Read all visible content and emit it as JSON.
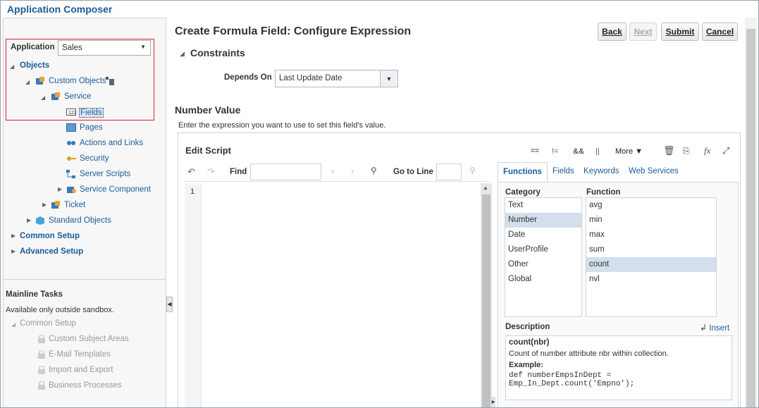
{
  "app_title": "Application Composer",
  "left": {
    "application_label": "Application",
    "application_value": "Sales",
    "tree": {
      "objects": "Objects",
      "custom_objects": "Custom Objects",
      "service": "Service",
      "fields": "Fields",
      "pages": "Pages",
      "actions_links": "Actions and Links",
      "security": "Security",
      "server_scripts": "Server Scripts",
      "service_component": "Service Component",
      "ticket": "Ticket",
      "standard_objects": "Standard Objects",
      "common_setup": "Common Setup",
      "advanced_setup": "Advanced Setup"
    },
    "tasks": {
      "title": "Mainline Tasks",
      "note": "Available only outside sandbox.",
      "common_setup": "Common Setup",
      "items": [
        "Custom Subject Areas",
        "E-Mail Templates",
        "Import and Export",
        "Business Processes"
      ]
    }
  },
  "main": {
    "title": "Create Formula Field: Configure Expression",
    "buttons": {
      "back": "Back",
      "next": "Next",
      "submit": "Submit",
      "cancel": "Cancel"
    },
    "constraints": "Constraints",
    "depends_on_label": "Depends On",
    "depends_on_value": "Last Update Date",
    "number_value": "Number Value",
    "instructions": "Enter the expression you want to use to set this field's value.",
    "edit_script": "Edit Script",
    "more": "More",
    "find": "Find",
    "go_to_line": "Go to Line",
    "line_number": "1",
    "tabs": [
      "Functions",
      "Fields",
      "Keywords",
      "Web Services"
    ],
    "category_label": "Category",
    "function_label": "Function",
    "categories": [
      "Text",
      "Number",
      "Date",
      "UserProfile",
      "Other",
      "Global"
    ],
    "selected_category": "Number",
    "functions": [
      "avg",
      "min",
      "max",
      "sum",
      "count",
      "nvl"
    ],
    "selected_function": "count",
    "description_label": "Description",
    "insert": "Insert",
    "desc_sig": "count(nbr)",
    "desc_text": "Count of number attribute nbr within collection.",
    "example_label": "Example:",
    "example_line1": "def numberEmpsInDept =",
    "example_line2": "Emp_In_Dept.count('Empno');"
  },
  "colors": {
    "accent": "#1c5b98",
    "highlight": "#d3dfed",
    "red_outline": "#d8232a"
  }
}
